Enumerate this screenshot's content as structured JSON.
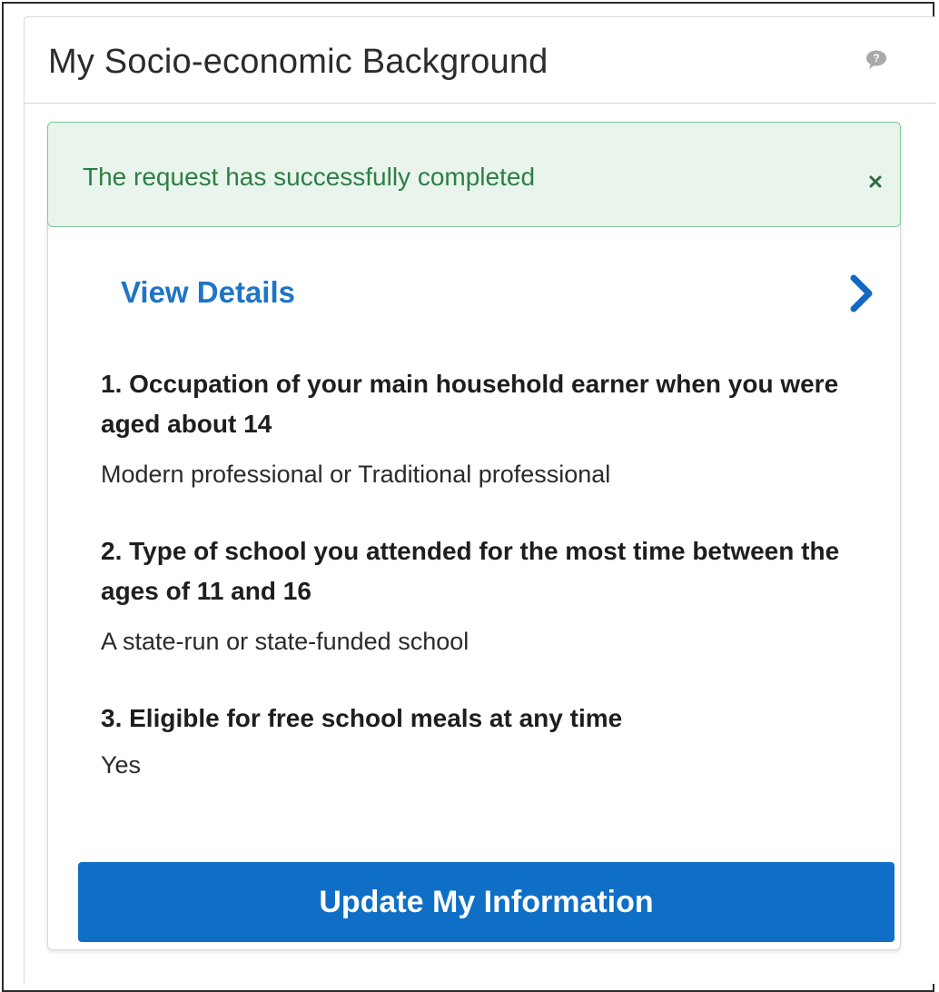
{
  "header": {
    "title": "My Socio-economic Background",
    "help_icon": "speech-bubble-icon"
  },
  "alert": {
    "message": "The request has successfully completed",
    "close_icon": "close-icon",
    "color": "#2e7d46",
    "background": "#e9f5ec"
  },
  "details": {
    "link_label": "View Details",
    "chevron_icon": "chevron-right-icon",
    "accent": "#1f74c7"
  },
  "questions": [
    {
      "question": "1. Occupation of your main household earner when you were aged about 14",
      "answer": "Modern professional or Traditional professional"
    },
    {
      "question": "2. Type of school you attended for the most time between the ages of 11 and 16",
      "answer": "A state-run or state-funded school"
    },
    {
      "question": "3. Eligible for free school meals at any time",
      "answer": "Yes"
    }
  ],
  "actions": {
    "update_label": "Update My Information",
    "button_color": "#0f6fc6"
  }
}
